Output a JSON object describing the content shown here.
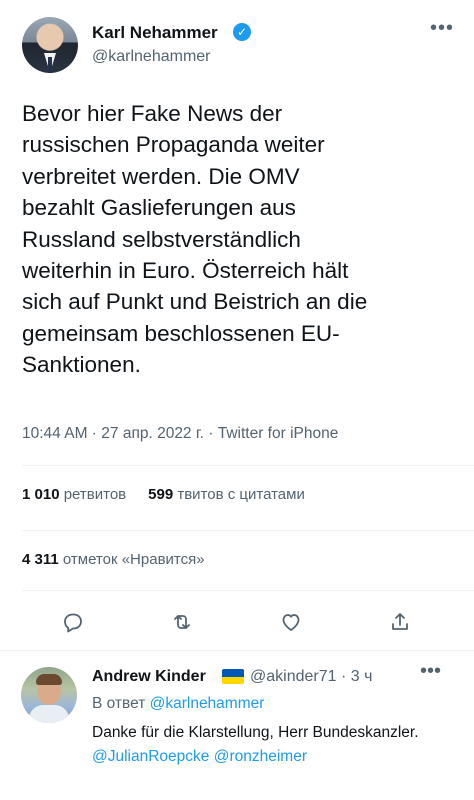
{
  "tweet": {
    "author_name": "Karl Nehammer",
    "author_handle": "@karlnehammer",
    "verified_glyph": "✓",
    "more_glyph": "•••",
    "text": "Bevor hier Fake News der\nrussischen Propaganda weiter\nverbreitet werden. Die OMV\nbezahlt  Gaslieferungen aus\nRussland selbstverständlich\nweiterhin in Euro. Österreich hält\nsich auf Punkt und Beistrich an die\ngemeinsam beschlossenen EU-\nSanktionen.",
    "time": "10:44 AM",
    "separator": " · ",
    "date": "27 апр. 2022 г.",
    "source": "Twitter for iPhone"
  },
  "stats": {
    "retweets_count": "1 010",
    "retweets_label": "ретвитов",
    "quotes_count": "599",
    "quotes_label": "твитов с цитатами",
    "likes_count": "4 311",
    "likes_label": "отметок «Нравится»"
  },
  "actions": [
    {
      "icon": "reply-icon"
    },
    {
      "icon": "retweet-icon"
    },
    {
      "icon": "like-icon"
    },
    {
      "icon": "share-icon"
    }
  ],
  "reply": {
    "author_name": "Andrew Kinder",
    "author_handle": "@akinder71",
    "time_ago": "3 ч",
    "separator": " · ",
    "more_glyph": "•••",
    "reply_to_label": "В ответ",
    "reply_to_handle": "@karlnehammer",
    "text_part1": "Danke für die Klarstellung, Herr Bundeskanzler.",
    "mention1": "@JulianRoepcke",
    "mention2": "@ronzheimer"
  },
  "colors": {
    "accent": "#1d9bf0",
    "text_primary": "#0f1419",
    "text_secondary": "#536471",
    "divider": "#eff3f4"
  }
}
